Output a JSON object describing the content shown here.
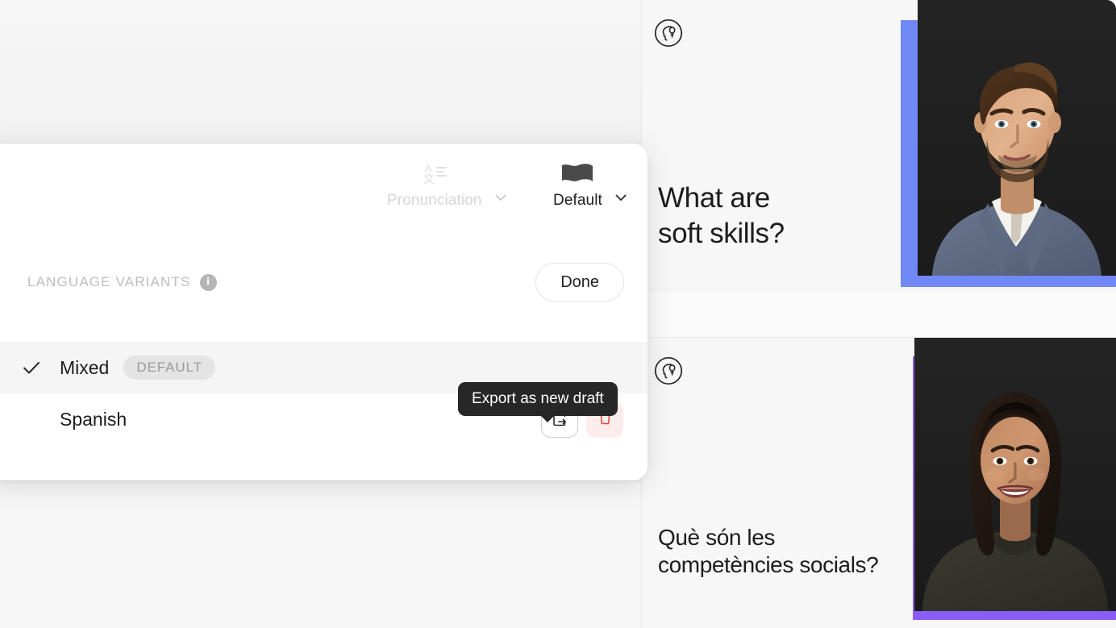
{
  "panel": {
    "controls": [
      {
        "id": "pronunciation",
        "label": "Pronunciation",
        "icon": "translate-icon",
        "state": "disabled"
      },
      {
        "id": "default_voice",
        "label": "Default",
        "icon": "flag-icon",
        "state": "active"
      }
    ],
    "section": {
      "title": "LANGUAGE VARIANTS",
      "info_icon": "info-icon",
      "info_glyph": "i",
      "done_label": "Done"
    },
    "variants": [
      {
        "name": "Mixed",
        "selected": true,
        "badge": "DEFAULT",
        "check_icon": "check-icon",
        "actions": []
      },
      {
        "name": "Spanish",
        "selected": false,
        "badge": "",
        "check_icon": "",
        "actions": [
          {
            "id": "export",
            "icon": "export-document-icon",
            "tooltip": "Export as new draft"
          },
          {
            "id": "delete",
            "icon": "trash-icon",
            "tooltip": ""
          }
        ]
      }
    ],
    "tooltip": {
      "text": "Export as new draft",
      "bg": "#272727",
      "fg": "#ffffff"
    }
  },
  "slides": [
    {
      "id": "slide-en",
      "avatar_icon": "head-idea-icon",
      "heading_lines": [
        "What are",
        "soft skills?"
      ],
      "accent_color": "#7089f7",
      "presenter": "male-presenter-photo"
    },
    {
      "id": "slide-ca",
      "avatar_icon": "head-idea-icon",
      "heading_lines": [
        "Què són les",
        "competències socials?"
      ],
      "accent_color": "#8b5cf6",
      "presenter": "female-presenter-photo"
    }
  ],
  "colors": {
    "accent_blue": "#7089f7",
    "accent_purple": "#8b5cf6",
    "danger_red": "#e8433a",
    "danger_bg": "#fdecec",
    "tooltip_bg": "#272727",
    "row_selected_bg": "#f5f5f5",
    "badge_bg": "#e4e4e4",
    "muted_text": "#bdbdbd"
  }
}
